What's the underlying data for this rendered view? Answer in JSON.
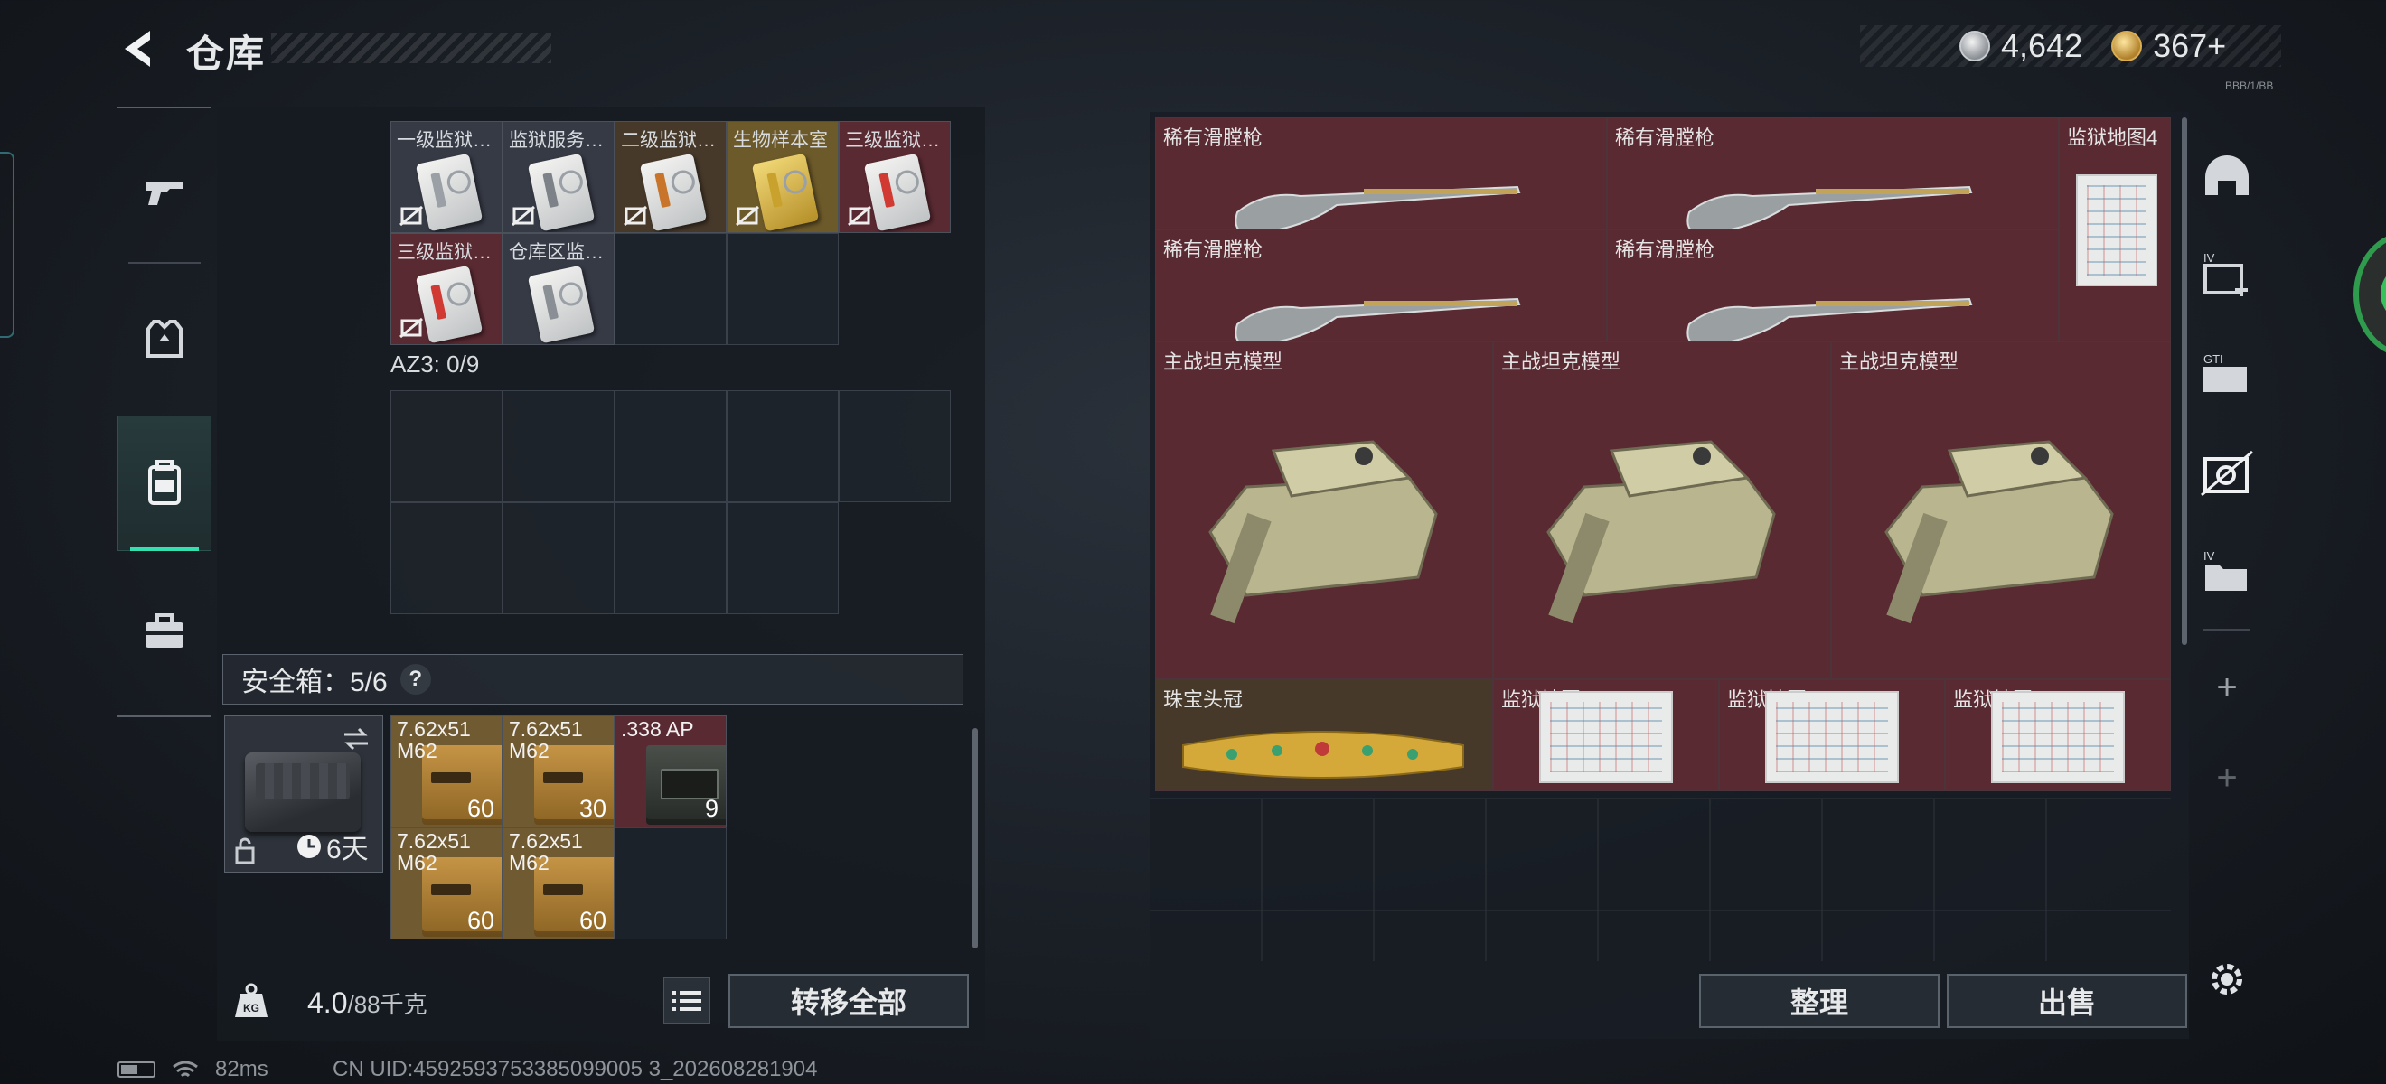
{
  "header": {
    "title": "仓库",
    "currency": [
      {
        "icon": "silver-coin-icon",
        "value": "4,642"
      },
      {
        "icon": "gold-coin-icon",
        "value": "367+"
      }
    ],
    "version": "BBB/1/BB"
  },
  "left_nav": [
    {
      "name": "weapons",
      "icon": "pistol-icon"
    },
    {
      "name": "armor",
      "icon": "vest-icon"
    },
    {
      "name": "backpack",
      "icon": "backpack-icon",
      "active": true
    },
    {
      "name": "toolbox",
      "icon": "briefcase-icon"
    }
  ],
  "keycards": [
    {
      "label": "一级监狱…",
      "color": "grey",
      "stripe": "#9aa0a6"
    },
    {
      "label": "监狱服务…",
      "color": "grey",
      "stripe": "#7d8288"
    },
    {
      "label": "二级监狱…",
      "color": "brown",
      "stripe": "#c8742a"
    },
    {
      "label": "生物样本室",
      "color": "gold",
      "stripe": "#c9a22e"
    },
    {
      "label": "三级监狱…",
      "color": "red",
      "stripe": "#d13a32"
    },
    {
      "label": "三级监狱…",
      "color": "red",
      "stripe": "#d13a32"
    },
    {
      "label": "仓库区监…",
      "color": "grey",
      "stripe": "#8a8f95"
    }
  ],
  "az3": {
    "label": "AZ3: 0/9"
  },
  "safebox": {
    "label": "安全箱：5/6",
    "help": "?",
    "duration": "6天"
  },
  "ammo": [
    {
      "name": "7.62x51 M62",
      "count": "60",
      "type": "box"
    },
    {
      "name": "7.62x51 M62",
      "count": "30",
      "type": "box"
    },
    {
      "name": ".338 AP",
      "count": "9",
      "type": "dark"
    },
    {
      "name": "7.62x51 M62",
      "count": "60",
      "type": "box"
    },
    {
      "name": "7.62x51 M62",
      "count": "60",
      "type": "box"
    }
  ],
  "weight": {
    "current": "4.0",
    "max": "/88千克"
  },
  "buttons": {
    "transfer_all": "转移全部",
    "sort": "整理",
    "sell": "出售"
  },
  "storage_items": {
    "rifles": [
      "稀有滑膛枪",
      "稀有滑膛枪",
      "稀有滑膛枪",
      "稀有滑膛枪"
    ],
    "map_top": "监狱地图4",
    "tanks": [
      "主战坦克模型",
      "主战坦克模型",
      "主战坦克模型"
    ],
    "crown": "珠宝头冠",
    "maps": [
      "监狱地图4",
      "监狱地图4",
      "监狱地图4"
    ]
  },
  "status": {
    "ping": "82ms",
    "uid": "CN UID:4592593753385099005 3_202608281904"
  },
  "colors": {
    "accent": "#34e0b0",
    "rare_red": "#5a2a32",
    "panel": "#161b21"
  }
}
